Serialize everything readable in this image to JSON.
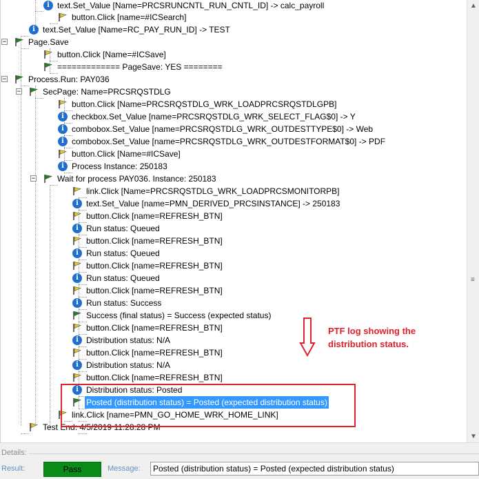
{
  "tree": {
    "rows": [
      {
        "icon": "info",
        "label": "text.Set_Value [Name=PRCSRUNCNTL_RUN_CNTL_ID] -> calc_payroll"
      },
      {
        "icon": "flag-yellow",
        "label": "button.Click  [name=#ICSearch]"
      },
      {
        "icon": "info",
        "label": "text.Set_Value [Name=RC_PAY_RUN_ID] -> TEST"
      },
      {
        "icon": "flag-green",
        "label": "Page.Save",
        "expander": "-"
      },
      {
        "icon": "flag-yellow",
        "label": "button.Click  [Name=#ICSave]"
      },
      {
        "icon": "flag-green",
        "label": "============= PageSave: YES ========"
      },
      {
        "icon": "flag-green",
        "label": "Process.Run: PAY036",
        "expander": "-"
      },
      {
        "icon": "flag-green",
        "label": "SecPage: Name=PRCSRQSTDLG",
        "expander": "-"
      },
      {
        "icon": "flag-yellow",
        "label": "button.Click  [Name=PRCSRQSTDLG_WRK_LOADPRCSRQSTDLGPB]"
      },
      {
        "icon": "info",
        "label": "checkbox.Set_Value [name=PRCSRQSTDLG_WRK_SELECT_FLAG$0] -> Y"
      },
      {
        "icon": "info",
        "label": "combobox.Set_Value [name=PRCSRQSTDLG_WRK_OUTDESTTYPE$0] -> Web"
      },
      {
        "icon": "info",
        "label": "combobox.Set_Value [name=PRCSRQSTDLG_WRK_OUTDESTFORMAT$0] -> PDF"
      },
      {
        "icon": "flag-yellow",
        "label": "button.Click  [Name=#ICSave]"
      },
      {
        "icon": "info",
        "label": "Process Instance: 250183"
      },
      {
        "icon": "flag-green",
        "label": "Wait for process PAY036. Instance: 250183",
        "expander": "-"
      },
      {
        "icon": "flag-yellow",
        "label": "link.Click  [Name=PRCSRQSTDLG_WRK_LOADPRCSMONITORPB]"
      },
      {
        "icon": "info",
        "label": "text.Set_Value [name=PMN_DERIVED_PRCSINSTANCE] -> 250183"
      },
      {
        "icon": "flag-yellow",
        "label": "button.Click  [name=REFRESH_BTN]"
      },
      {
        "icon": "info",
        "label": "Run status: Queued"
      },
      {
        "icon": "flag-yellow",
        "label": "button.Click  [name=REFRESH_BTN]"
      },
      {
        "icon": "info",
        "label": "Run status: Queued"
      },
      {
        "icon": "flag-yellow",
        "label": "button.Click  [name=REFRESH_BTN]"
      },
      {
        "icon": "info",
        "label": "Run status: Queued"
      },
      {
        "icon": "flag-yellow",
        "label": "button.Click  [name=REFRESH_BTN]"
      },
      {
        "icon": "info",
        "label": "Run status: Success"
      },
      {
        "icon": "flag-green",
        "label": "Success (final status) = Success (expected status)"
      },
      {
        "icon": "flag-yellow",
        "label": "button.Click  [name=REFRESH_BTN]"
      },
      {
        "icon": "info",
        "label": "Distribution status: N/A"
      },
      {
        "icon": "flag-yellow",
        "label": "button.Click  [name=REFRESH_BTN]"
      },
      {
        "icon": "info",
        "label": "Distribution status: N/A"
      },
      {
        "icon": "flag-yellow",
        "label": "button.Click  [name=REFRESH_BTN]"
      },
      {
        "icon": "info",
        "label": "Distribution status: Posted"
      },
      {
        "icon": "flag-green",
        "label": "Posted (distribution status) = Posted (expected distribution status)",
        "selected": true
      },
      {
        "icon": "flag-yellow",
        "label": "link.Click  [name=PMN_GO_HOME_WRK_HOME_LINK]"
      },
      {
        "icon": "flag-yellow",
        "label": "Test End: 4/5/2019 11:28:28 PM"
      }
    ]
  },
  "annotation": {
    "text": "PTF log showing the distribution status."
  },
  "details": {
    "section_label": "Details:",
    "result_label": "Result:",
    "result_value": "Pass",
    "message_label": "Message:",
    "message_value": "Posted (distribution status) = Posted (expected distribution status)"
  },
  "colors": {
    "info": "#1f6fd1",
    "flag_green": "#1a8a1a",
    "flag_yellow": "#e8c92a",
    "selection": "#3399ff",
    "highlight_box": "#e0202a",
    "pass": "#0a8c18"
  },
  "icons": {
    "info": "info-icon",
    "flag_green": "green-flag-icon",
    "flag_yellow": "yellow-flag-icon",
    "scroll_up": "chevron-up-icon",
    "scroll_down": "chevron-down-icon",
    "grip": "scroll-grip-icon",
    "arrow": "down-arrow-icon"
  }
}
